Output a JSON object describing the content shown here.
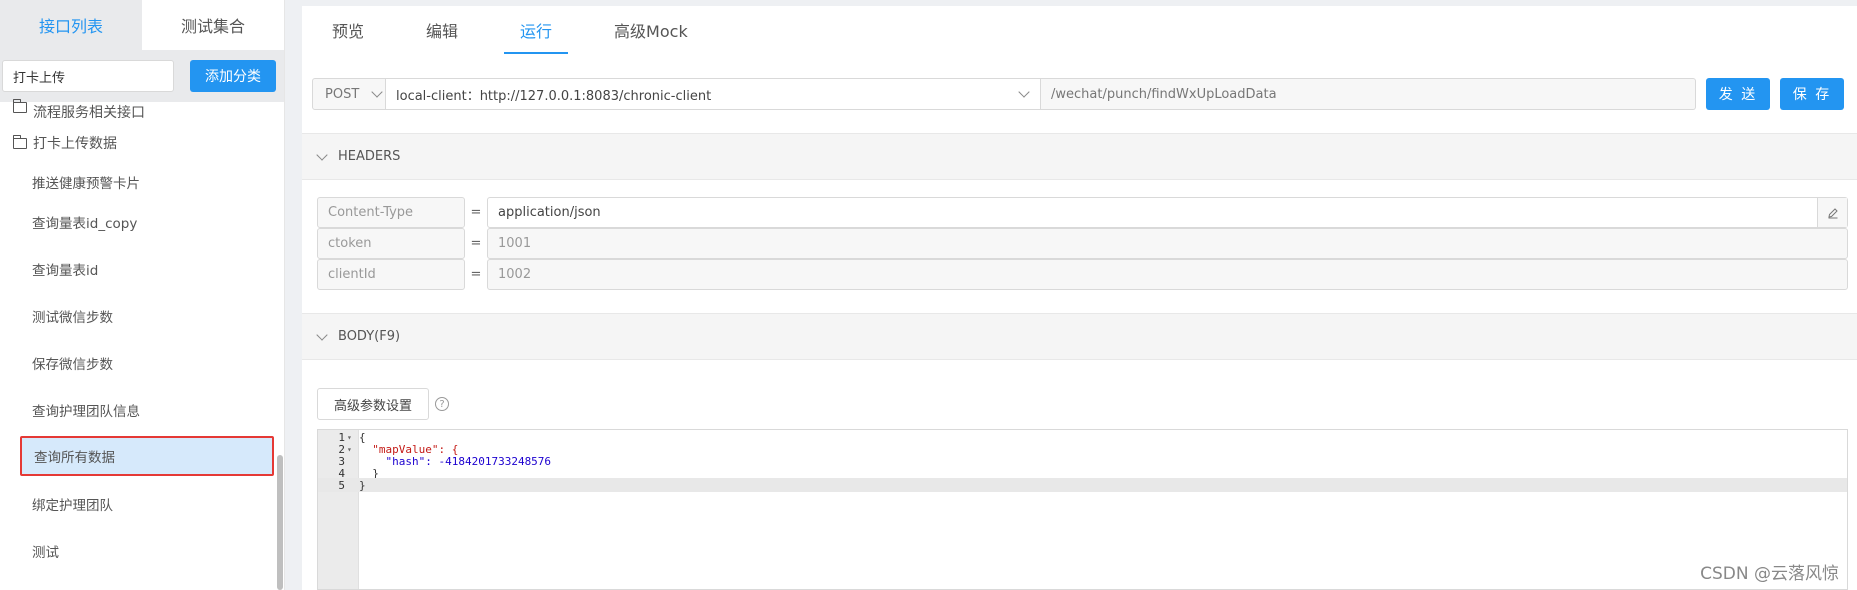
{
  "sidebar": {
    "tabs": [
      {
        "label": "接口列表"
      },
      {
        "label": "测试集合"
      }
    ],
    "search_value": "打卡上传",
    "add_button": "添加分类",
    "folders": [
      {
        "label": "流程服务相关接口"
      },
      {
        "label": "打卡上传数据"
      }
    ],
    "items": [
      {
        "label": "推送健康预警卡片"
      },
      {
        "label": "查询量表id_copy"
      },
      {
        "label": "查询量表id"
      },
      {
        "label": "测试微信步数"
      },
      {
        "label": "保存微信步数"
      },
      {
        "label": "查询护理团队信息"
      },
      {
        "label": "查询所有数据"
      },
      {
        "label": "绑定护理团队"
      },
      {
        "label": "测试"
      }
    ]
  },
  "main": {
    "tabs": [
      {
        "label": "预览"
      },
      {
        "label": "编辑"
      },
      {
        "label": "运行"
      },
      {
        "label": "高级Mock"
      }
    ],
    "method": "POST",
    "env": "local-client：http://127.0.0.1:8083/chronic-client",
    "path": "/wechat/punch/findWxUpLoadData",
    "send_label": "发 送",
    "save_label": "保 存",
    "headers_title": "HEADERS",
    "headers": [
      {
        "key": "Content-Type",
        "value": "application/json"
      },
      {
        "key": "ctoken",
        "value": "1001"
      },
      {
        "key": "clientId",
        "value": "1002"
      }
    ],
    "body_title": "BODY(F9)",
    "adv_button": "高级参数设置",
    "help_icon": "?",
    "code_lines": [
      {
        "num": "1",
        "fold": "▾",
        "text": "{"
      },
      {
        "num": "2",
        "fold": "▾",
        "text": "  \"mapValue\": {"
      },
      {
        "num": "3",
        "fold": "",
        "text": "    \"hash\": -4184201733248576"
      },
      {
        "num": "4",
        "fold": "",
        "text": "  }"
      },
      {
        "num": "5",
        "fold": "",
        "text": "}"
      }
    ]
  },
  "watermark": "CSDN @云落风惊",
  "colors": {
    "accent": "#2395f1",
    "highlight_border": "#e53935",
    "selected_bg": "#d6e9fb"
  }
}
